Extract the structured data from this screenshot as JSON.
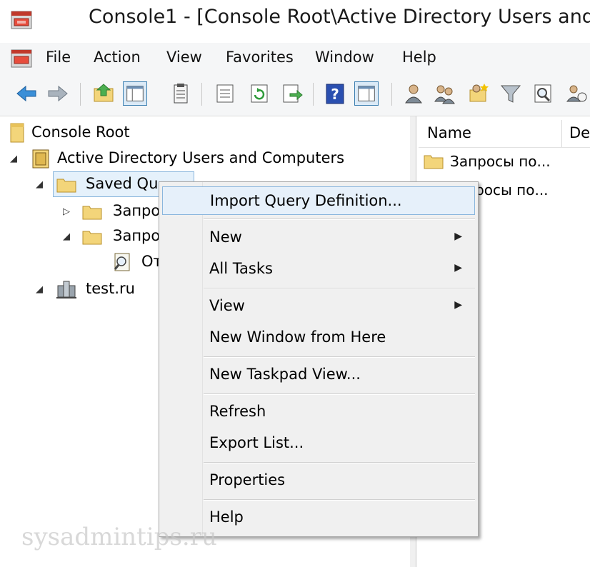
{
  "window": {
    "title": "Console1 - [Console Root\\Active Directory Users and"
  },
  "menubar": {
    "items": [
      "File",
      "Action",
      "View",
      "Favorites",
      "Window",
      "Help"
    ]
  },
  "toolbar": {
    "icons": [
      "back-arrow-icon",
      "forward-arrow-icon",
      "up-folder-icon",
      "show-hide-tree-icon",
      "properties-icon",
      "export-list-icon",
      "refresh-icon",
      "export-icon",
      "help-icon",
      "show-action-pane-icon",
      "users-icon",
      "groups-icon",
      "new-ou-icon",
      "filter-icon",
      "find-icon",
      "add-to-group-icon"
    ]
  },
  "tree": {
    "root": "Console Root",
    "aduc": "Active Directory Users and Computers",
    "saved_queries": "Saved Qu",
    "query1": "Запро",
    "query2": "Запро",
    "query2_child": "От",
    "domain": "test.ru"
  },
  "list": {
    "columns": [
      "Name",
      "De"
    ],
    "rows": [
      "Запросы по...",
      "просы по..."
    ]
  },
  "context_menu": {
    "items": [
      {
        "label": "Import Query Definition...",
        "submenu": false
      },
      {
        "label": "New",
        "submenu": true
      },
      {
        "label": "All Tasks",
        "submenu": true
      },
      {
        "label": "View",
        "submenu": true
      },
      {
        "label": "New Window from Here",
        "submenu": false
      },
      {
        "label": "New Taskpad View...",
        "submenu": false
      },
      {
        "label": "Refresh",
        "submenu": false
      },
      {
        "label": "Export List...",
        "submenu": false
      },
      {
        "label": "Properties",
        "submenu": false
      },
      {
        "label": "Help",
        "submenu": false
      }
    ],
    "arrow_glyph": "▶"
  },
  "watermark": "sysadmintips.ru",
  "colors": {
    "selection": "#e5f1fb",
    "selection_border": "#8ab6dd",
    "folder": "#f3d57a",
    "help_blue": "#2a4fb0"
  }
}
